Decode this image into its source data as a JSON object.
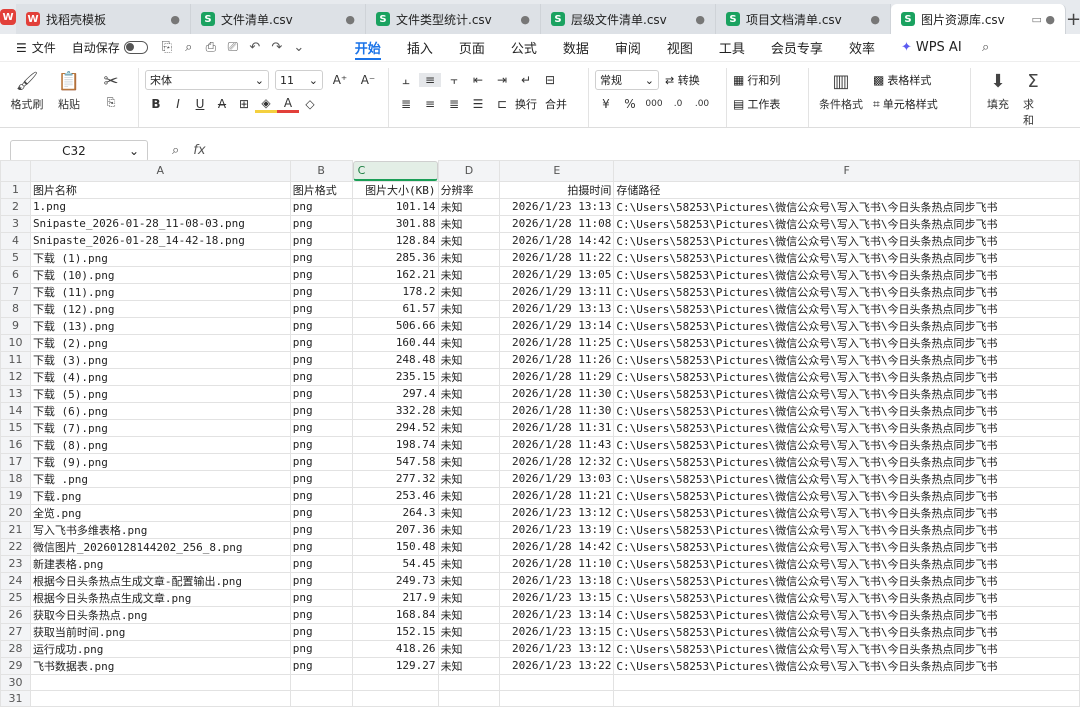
{
  "tabs": [
    {
      "label": "找稻壳模板",
      "type": "r"
    },
    {
      "label": "文件清单.csv",
      "type": "g"
    },
    {
      "label": "文件类型统计.csv",
      "type": "g"
    },
    {
      "label": "层级文件清单.csv",
      "type": "g"
    },
    {
      "label": "项目文档清单.csv",
      "type": "g"
    },
    {
      "label": "图片资源库.csv",
      "type": "g"
    }
  ],
  "menu": {
    "file": "文件",
    "autosave": "自动保存"
  },
  "ribbon_tabs": [
    "开始",
    "插入",
    "页面",
    "公式",
    "数据",
    "审阅",
    "视图",
    "工具",
    "会员专享",
    "效率"
  ],
  "wps_ai": "WPS AI",
  "ribbon": {
    "format_painter": "格式刷",
    "paste": "粘贴",
    "font": "宋体",
    "font_size": "11",
    "number_format": "常规",
    "convert": "转换",
    "rows_cols": "行和列",
    "table_style": "表格样式",
    "wrap": "换行",
    "merge": "合并",
    "worksheet": "工作表",
    "cond_format": "条件格式",
    "cell_style": "单元格样式",
    "fill": "填充",
    "sum": "求和"
  },
  "cell_ref": "C32",
  "columns": [
    "A",
    "B",
    "C",
    "D",
    "E",
    "F"
  ],
  "header": [
    "图片名称",
    "图片格式",
    "图片大小(KB)",
    "分辨率",
    "拍摄时间",
    "存储路径"
  ],
  "rows": [
    [
      "1.png",
      "png",
      "101.14",
      "未知",
      "2026/1/23 13:13",
      "C:\\Users\\58253\\Pictures\\微信公众号\\写入飞书\\今日头条热点同步飞书"
    ],
    [
      "Snipaste_2026-01-28_11-08-03.png",
      "png",
      "301.88",
      "未知",
      "2026/1/28 11:08",
      "C:\\Users\\58253\\Pictures\\微信公众号\\写入飞书\\今日头条热点同步飞书"
    ],
    [
      "Snipaste_2026-01-28_14-42-18.png",
      "png",
      "128.84",
      "未知",
      "2026/1/28 14:42",
      "C:\\Users\\58253\\Pictures\\微信公众号\\写入飞书\\今日头条热点同步飞书"
    ],
    [
      "下载 (1).png",
      "png",
      "285.36",
      "未知",
      "2026/1/28 11:22",
      "C:\\Users\\58253\\Pictures\\微信公众号\\写入飞书\\今日头条热点同步飞书"
    ],
    [
      "下载 (10).png",
      "png",
      "162.21",
      "未知",
      "2026/1/29 13:05",
      "C:\\Users\\58253\\Pictures\\微信公众号\\写入飞书\\今日头条热点同步飞书"
    ],
    [
      "下载 (11).png",
      "png",
      "178.2",
      "未知",
      "2026/1/29 13:11",
      "C:\\Users\\58253\\Pictures\\微信公众号\\写入飞书\\今日头条热点同步飞书"
    ],
    [
      "下载 (12).png",
      "png",
      "61.57",
      "未知",
      "2026/1/29 13:13",
      "C:\\Users\\58253\\Pictures\\微信公众号\\写入飞书\\今日头条热点同步飞书"
    ],
    [
      "下载 (13).png",
      "png",
      "506.66",
      "未知",
      "2026/1/29 13:14",
      "C:\\Users\\58253\\Pictures\\微信公众号\\写入飞书\\今日头条热点同步飞书"
    ],
    [
      "下载 (2).png",
      "png",
      "160.44",
      "未知",
      "2026/1/28 11:25",
      "C:\\Users\\58253\\Pictures\\微信公众号\\写入飞书\\今日头条热点同步飞书"
    ],
    [
      "下载 (3).png",
      "png",
      "248.48",
      "未知",
      "2026/1/28 11:26",
      "C:\\Users\\58253\\Pictures\\微信公众号\\写入飞书\\今日头条热点同步飞书"
    ],
    [
      "下载 (4).png",
      "png",
      "235.15",
      "未知",
      "2026/1/28 11:29",
      "C:\\Users\\58253\\Pictures\\微信公众号\\写入飞书\\今日头条热点同步飞书"
    ],
    [
      "下载 (5).png",
      "png",
      "297.4",
      "未知",
      "2026/1/28 11:30",
      "C:\\Users\\58253\\Pictures\\微信公众号\\写入飞书\\今日头条热点同步飞书"
    ],
    [
      "下载 (6).png",
      "png",
      "332.28",
      "未知",
      "2026/1/28 11:30",
      "C:\\Users\\58253\\Pictures\\微信公众号\\写入飞书\\今日头条热点同步飞书"
    ],
    [
      "下载 (7).png",
      "png",
      "294.52",
      "未知",
      "2026/1/28 11:31",
      "C:\\Users\\58253\\Pictures\\微信公众号\\写入飞书\\今日头条热点同步飞书"
    ],
    [
      "下载 (8).png",
      "png",
      "198.74",
      "未知",
      "2026/1/28 11:43",
      "C:\\Users\\58253\\Pictures\\微信公众号\\写入飞书\\今日头条热点同步飞书"
    ],
    [
      "下载 (9).png",
      "png",
      "547.58",
      "未知",
      "2026/1/28 12:32",
      "C:\\Users\\58253\\Pictures\\微信公众号\\写入飞书\\今日头条热点同步飞书"
    ],
    [
      "下载 .png",
      "png",
      "277.32",
      "未知",
      "2026/1/29 13:03",
      "C:\\Users\\58253\\Pictures\\微信公众号\\写入飞书\\今日头条热点同步飞书"
    ],
    [
      "下载.png",
      "png",
      "253.46",
      "未知",
      "2026/1/28 11:21",
      "C:\\Users\\58253\\Pictures\\微信公众号\\写入飞书\\今日头条热点同步飞书"
    ],
    [
      "全览.png",
      "png",
      "264.3",
      "未知",
      "2026/1/23 13:12",
      "C:\\Users\\58253\\Pictures\\微信公众号\\写入飞书\\今日头条热点同步飞书"
    ],
    [
      "写入飞书多维表格.png",
      "png",
      "207.36",
      "未知",
      "2026/1/23 13:19",
      "C:\\Users\\58253\\Pictures\\微信公众号\\写入飞书\\今日头条热点同步飞书"
    ],
    [
      "微信图片_20260128144202_256_8.png",
      "png",
      "150.48",
      "未知",
      "2026/1/28 14:42",
      "C:\\Users\\58253\\Pictures\\微信公众号\\写入飞书\\今日头条热点同步飞书"
    ],
    [
      "新建表格.png",
      "png",
      "54.45",
      "未知",
      "2026/1/28 11:10",
      "C:\\Users\\58253\\Pictures\\微信公众号\\写入飞书\\今日头条热点同步飞书"
    ],
    [
      "根据今日头条热点生成文章-配置输出.png",
      "png",
      "249.73",
      "未知",
      "2026/1/23 13:18",
      "C:\\Users\\58253\\Pictures\\微信公众号\\写入飞书\\今日头条热点同步飞书"
    ],
    [
      "根据今日头条热点生成文章.png",
      "png",
      "217.9",
      "未知",
      "2026/1/23 13:15",
      "C:\\Users\\58253\\Pictures\\微信公众号\\写入飞书\\今日头条热点同步飞书"
    ],
    [
      "获取今日头条热点.png",
      "png",
      "168.84",
      "未知",
      "2026/1/23 13:14",
      "C:\\Users\\58253\\Pictures\\微信公众号\\写入飞书\\今日头条热点同步飞书"
    ],
    [
      "获取当前时间.png",
      "png",
      "152.15",
      "未知",
      "2026/1/23 13:15",
      "C:\\Users\\58253\\Pictures\\微信公众号\\写入飞书\\今日头条热点同步飞书"
    ],
    [
      "运行成功.png",
      "png",
      "418.26",
      "未知",
      "2026/1/23 13:12",
      "C:\\Users\\58253\\Pictures\\微信公众号\\写入飞书\\今日头条热点同步飞书"
    ],
    [
      "飞书数据表.png",
      "png",
      "129.27",
      "未知",
      "2026/1/23 13:22",
      "C:\\Users\\58253\\Pictures\\微信公众号\\写入飞书\\今日头条热点同步飞书"
    ]
  ],
  "empty_rows": [
    30,
    31
  ]
}
